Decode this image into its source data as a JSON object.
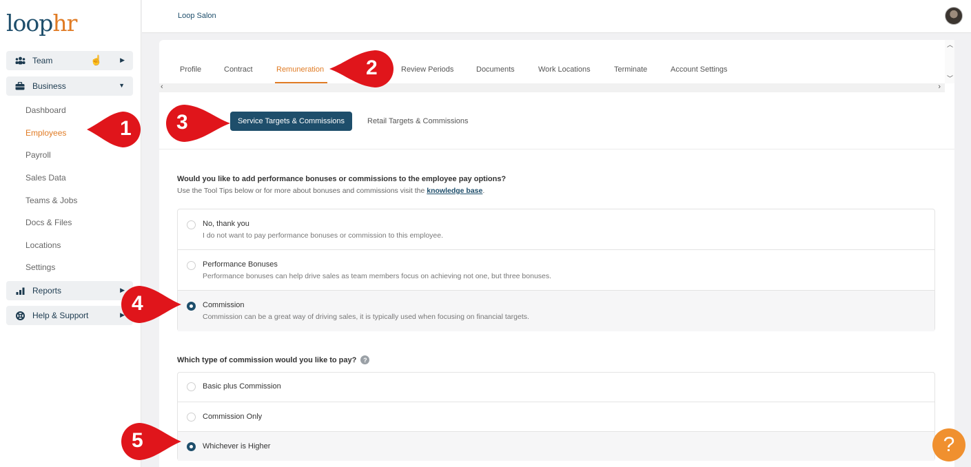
{
  "logo": {
    "part1": "loop",
    "part2": "hr"
  },
  "company_name": "Loop Salon",
  "sidebar": {
    "groups": {
      "team": "Team",
      "business": "Business",
      "reports": "Reports",
      "help": "Help & Support"
    },
    "business_items": [
      "Dashboard",
      "Employees",
      "Payroll",
      "Sales Data",
      "Teams & Jobs",
      "Docs & Files",
      "Locations",
      "Settings"
    ],
    "active_item": "Employees"
  },
  "tabs": [
    "Profile",
    "Contract",
    "Remuneration",
    "Review Periods",
    "Documents",
    "Work Locations",
    "Terminate",
    "Account Settings"
  ],
  "active_tab": "Remuneration",
  "subtabs": {
    "active": "Service Targets & Commissions",
    "other": "Retail Targets & Commissions"
  },
  "question1": {
    "title": "Would you like to add performance bonuses or commissions to the employee pay options?",
    "subtitle_pre": "Use the Tool Tips below or for more about bonuses and commissions visit the ",
    "link": "knowledge base",
    "subtitle_post": ".",
    "options": [
      {
        "title": "No, thank you",
        "desc": "I do not want to pay performance bonuses or commission to this employee.",
        "selected": false
      },
      {
        "title": "Performance Bonuses",
        "desc": "Performance bonuses can help drive sales as team members focus on achieving not one, but three bonuses.",
        "selected": false
      },
      {
        "title": "Commission",
        "desc": "Commission can be a great way of driving sales, it is typically used when focusing on financial targets.",
        "selected": true
      }
    ]
  },
  "question2": {
    "title": "Which type of commission would you like to pay?",
    "help_icon": "?",
    "options": [
      {
        "title": "Basic plus Commission",
        "selected": false
      },
      {
        "title": "Commission Only",
        "selected": false
      },
      {
        "title": "Whichever is Higher",
        "selected": true
      }
    ]
  },
  "callouts": [
    "1",
    "2",
    "3",
    "4",
    "5"
  ],
  "help_button": "?",
  "colors": {
    "brand": "#1e4e6b",
    "accent": "#e07b24",
    "callout": "#e0151b",
    "help": "#f0902f"
  }
}
